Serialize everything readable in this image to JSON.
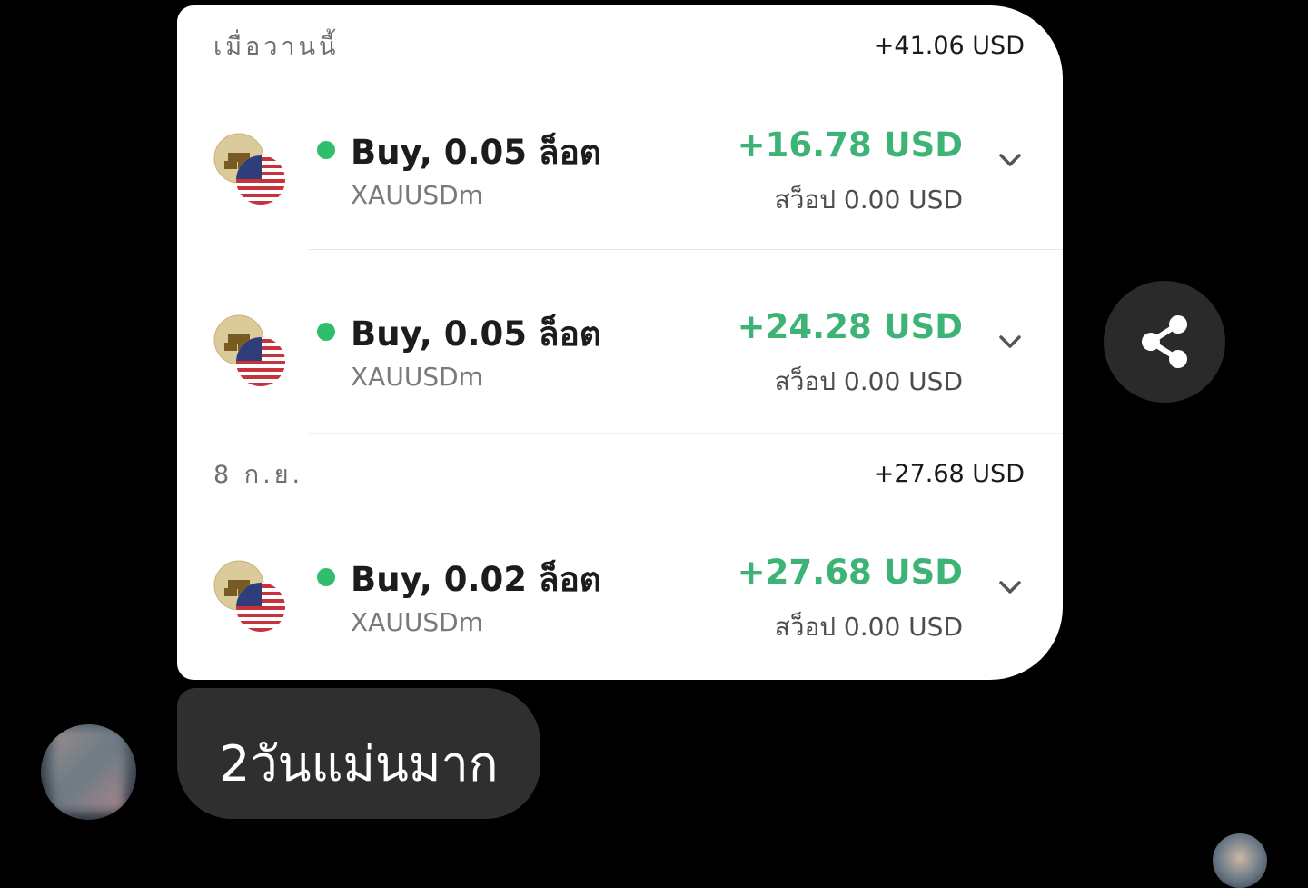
{
  "colors": {
    "profit_green": "#3db375",
    "status_dot_green": "#2fbf6c",
    "chevron_gray": "#555555"
  },
  "card": {
    "groups": [
      {
        "date": "เมื่อวานนี้",
        "total": "+41.06 USD",
        "trades": [
          {
            "title": "Buy, 0.05 ล็อต",
            "symbol": "XAUUSDm",
            "profit": "+16.78 USD",
            "swap": "สว็อป 0.00 USD",
            "icon": "gold-usd-pair-icon",
            "status": "open"
          },
          {
            "title": "Buy, 0.05 ล็อต",
            "symbol": "XAUUSDm",
            "profit": "+24.28 USD",
            "swap": "สว็อป 0.00 USD",
            "icon": "gold-usd-pair-icon",
            "status": "open"
          }
        ]
      },
      {
        "date": "8 ก.ย.",
        "total": "+27.68 USD",
        "trades": [
          {
            "title": "Buy, 0.02 ล็อต",
            "symbol": "XAUUSDm",
            "profit": "+27.68 USD",
            "swap": "สว็อป 0.00 USD",
            "icon": "gold-usd-pair-icon",
            "status": "open"
          }
        ]
      }
    ]
  },
  "share": {
    "icon": "share-icon"
  },
  "message": {
    "text": "2วันแม่นมาก"
  }
}
